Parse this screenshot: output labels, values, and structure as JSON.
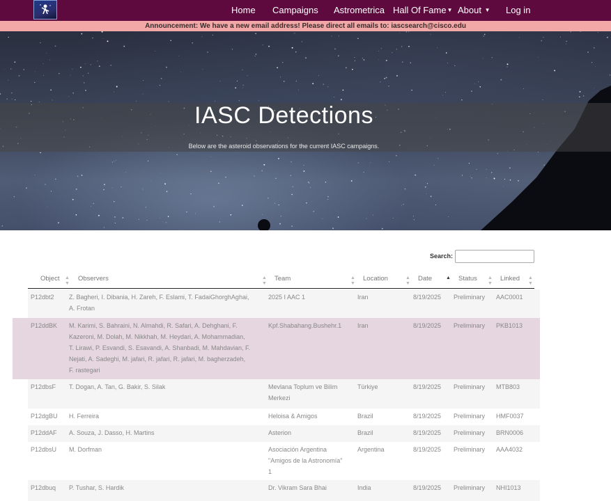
{
  "nav": {
    "logo_icon": "observer-telescope-icon",
    "items": [
      "Home",
      "Campaigns",
      "Astrometrica",
      "Hall Of Fame",
      "About",
      "Log in"
    ]
  },
  "announcement": "Announcement: We have a new email address! Please direct all emails to: iascsearch@cisco.edu",
  "hero": {
    "title": "IASC Detections",
    "subtitle": "Below are the asteroid observations for the current IASC campaigns."
  },
  "search": {
    "label": "Search:",
    "value": ""
  },
  "table": {
    "columns": [
      "Object",
      "Observers",
      "Team",
      "Location",
      "Date",
      "Status",
      "Linked"
    ],
    "sorted_column": "Date",
    "rows": [
      {
        "object": "P12dbt2",
        "observers": [
          "Z. Bagheri, I. Dibania, H. Zareh, F. Eslami, T. FadaiGhorghAghai,",
          "A. Frotan"
        ],
        "team": [
          "2025 I AAC 1"
        ],
        "location": "Iran",
        "date": "8/19/2025",
        "status": "Preliminary",
        "linked": "AAC0001"
      },
      {
        "object": "P12ddBK",
        "observers": [
          "M. Karimi, S. Bahraini, N. Almahdi, R. Safari, A. Dehghani, F.",
          "Kazeroni, M. Dolah, M. Nikkhah, M. Heydari, A. Mohammadian,",
          "T. Lirawi, P. Esvandi, S. Esavandi, A. Shanbadi, M. Mahdavian, F.",
          "Nejati, A. Sadeghi, M. jafari, R. jafari, R. jafari, M. bagherzadeh,",
          "F. rastegari"
        ],
        "team": [
          "Kpf.Shabahang.Bushehr.1"
        ],
        "location": "Iran",
        "date": "8/19/2025",
        "status": "Preliminary",
        "linked": "PKB1013"
      },
      {
        "object": "P12dbsF",
        "observers": [
          "T. Dogan, A. Tan, G. Bakir, S. Silak"
        ],
        "team": [
          "Mevlana Toplum ve Bilim",
          "Merkezi"
        ],
        "location": "Türkiye",
        "date": "8/19/2025",
        "status": "Preliminary",
        "linked": "MTB803"
      },
      {
        "object": "P12dgBU",
        "observers": [
          "H. Ferreira"
        ],
        "team": [
          "Heloisa & Amigos"
        ],
        "location": "Brazil",
        "date": "8/19/2025",
        "status": "Preliminary",
        "linked": "HMF0037"
      },
      {
        "object": "P12ddAF",
        "observers": [
          "A. Souza, J. Dasso, H. Martins"
        ],
        "team": [
          "Asterion"
        ],
        "location": "Brazil",
        "date": "8/19/2025",
        "status": "Preliminary",
        "linked": "BRN0006"
      },
      {
        "object": "P12dbsU",
        "observers": [
          "M. Dorfman"
        ],
        "team": [
          "Asociación Argentina",
          "\"Amigos de la Astronomía\"",
          "1"
        ],
        "location": "Argentina",
        "date": "8/19/2025",
        "status": "Preliminary",
        "linked": "AAA4032"
      },
      {
        "object": "P12dbuq",
        "observers": [
          "P. Tushar, S. Hardik"
        ],
        "team": [
          "Dr. Vikram Sara Bhai"
        ],
        "location": "India",
        "date": "8/19/2025",
        "status": "Preliminary",
        "linked": "NHI1013"
      }
    ]
  }
}
